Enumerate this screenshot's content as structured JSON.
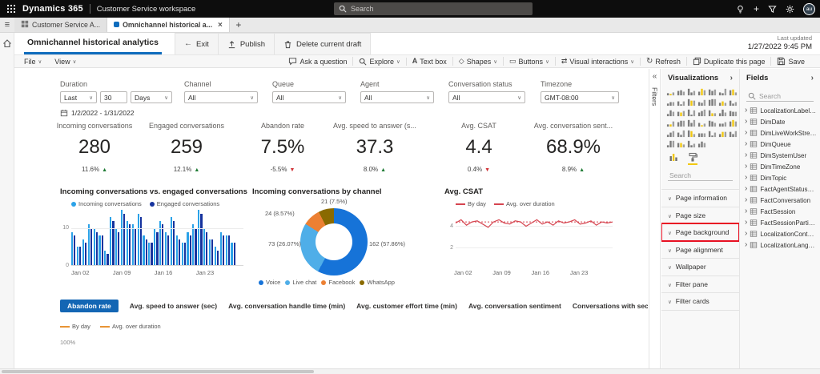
{
  "topbar": {
    "brand": "Dynamics 365",
    "app_name": "Customer Service workspace",
    "search_placeholder": "Search",
    "icons": [
      "lightbulb-icon",
      "add-icon",
      "filter-icon",
      "settings-icon"
    ],
    "avatar_initials": "au"
  },
  "browser_tabs": {
    "tab1_label": "Customer Service A...",
    "tab2_label": "Omnichannel historical a..."
  },
  "page_header": {
    "title_tab": "Omnichannel historical analytics",
    "exit_label": "Exit",
    "publish_label": "Publish",
    "delete_label": "Delete current draft",
    "last_updated_label": "Last updated",
    "last_updated_value": "1/27/2022 9:45 PM"
  },
  "menubar": {
    "file_label": "File",
    "view_label": "View",
    "tools": [
      {
        "label": "Ask a question",
        "icon": "chat-icon",
        "chevron": false
      },
      {
        "label": "Explore",
        "icon": "explore-icon",
        "chevron": true
      },
      {
        "label": "Text box",
        "icon": "textbox-icon",
        "chevron": false
      },
      {
        "label": "Shapes",
        "icon": "shapes-icon",
        "chevron": true
      },
      {
        "label": "Buttons",
        "icon": "buttons-icon",
        "chevron": true
      },
      {
        "label": "Visual interactions",
        "icon": "interactions-icon",
        "chevron": true
      },
      {
        "label": "Refresh",
        "icon": "refresh-icon",
        "chevron": false
      },
      {
        "label": "Duplicate this page",
        "icon": "duplicate-icon",
        "chevron": false
      },
      {
        "label": "Save",
        "icon": "save-icon",
        "chevron": false
      }
    ]
  },
  "filter_bar": {
    "duration": {
      "label": "Duration",
      "parts": [
        {
          "value": "Last"
        },
        {
          "value": "30"
        },
        {
          "value": "Days"
        }
      ]
    },
    "channel": {
      "label": "Channel",
      "value": "All"
    },
    "queue": {
      "label": "Queue",
      "value": "All"
    },
    "agent": {
      "label": "Agent",
      "value": "All"
    },
    "status": {
      "label": "Conversation status",
      "value": "All"
    },
    "timezone": {
      "label": "Timezone",
      "value": "GMT-08:00"
    },
    "date_range": "1/2/2022 - 1/31/2022"
  },
  "kpis": [
    {
      "label": "Incoming conversations",
      "value": "280",
      "delta": "11.6%",
      "dir": "up"
    },
    {
      "label": "Engaged conversations",
      "value": "259",
      "delta": "12.1%",
      "dir": "up"
    },
    {
      "label": "Abandon rate",
      "value": "7.5%",
      "delta": "-5.5%",
      "dir": "down"
    },
    {
      "label": "Avg. speed to answer (s...",
      "value": "37.3",
      "delta": "8.0%",
      "dir": "up"
    },
    {
      "label": "Avg. CSAT",
      "value": "4.4",
      "delta": "0.4%",
      "dir": "down"
    },
    {
      "label": "Avg. conversation sent...",
      "value": "68.9%",
      "delta": "8.9%",
      "dir": "up"
    }
  ],
  "chart_data": [
    {
      "type": "bar",
      "title": "Incoming conversations vs. engaged conversations",
      "xticks": [
        "Jan 02",
        "Jan 09",
        "Jan 16",
        "Jan 23"
      ],
      "yticks": [
        "10",
        "0"
      ],
      "ylim": [
        0,
        15
      ],
      "series": [
        {
          "name": "Incoming conversations",
          "color": "#2ba2e8",
          "values": [
            9,
            5,
            7,
            11,
            10,
            8,
            4,
            13,
            10,
            15,
            12,
            11,
            14,
            8,
            6,
            10,
            12,
            9,
            13,
            8,
            6,
            9,
            11,
            15,
            10,
            7,
            5,
            9,
            8,
            6
          ]
        },
        {
          "name": "Engaged conversations",
          "color": "#16339e",
          "values": [
            8,
            5,
            6,
            10,
            9,
            8,
            3,
            12,
            9,
            14,
            11,
            10,
            13,
            7,
            6,
            9,
            11,
            8,
            12,
            7,
            6,
            8,
            10,
            14,
            9,
            7,
            4,
            8,
            8,
            6
          ]
        }
      ]
    },
    {
      "type": "donut",
      "title": "Incoming conversations by channel",
      "slices": [
        {
          "name": "Voice",
          "value": 162,
          "label": "162 (57.86%)",
          "color": "#1673d8"
        },
        {
          "name": "Live chat",
          "value": 73,
          "label": "73 (26.07%)",
          "color": "#4faee8"
        },
        {
          "name": "Facebook",
          "value": 24,
          "label": "24 (8.57%)",
          "color": "#ec8033"
        },
        {
          "name": "WhatsApp",
          "value": 21,
          "label": "21 (7.5%)",
          "color": "#8a6a00"
        }
      ]
    },
    {
      "type": "line",
      "title": "Avg. CSAT",
      "legend": [
        "By day",
        "Avg. over duration"
      ],
      "color": "#d64550",
      "ylim": [
        1,
        5
      ],
      "yticks": [
        "4",
        "2"
      ],
      "xticks": [
        "Jan 02",
        "Jan 09",
        "Jan 16",
        "Jan 23"
      ],
      "avg": 4.4,
      "values": [
        4.3,
        4.6,
        4.1,
        4.4,
        4.5,
        4.2,
        3.9,
        4.4,
        4.6,
        4.3,
        4.2,
        4.5,
        4.4,
        4.0,
        4.3,
        4.6,
        4.2,
        4.4,
        4.1,
        4.5,
        4.3,
        4.4,
        4.6,
        4.2,
        4.3,
        4.5,
        4.1,
        4.4,
        4.3,
        4.4
      ]
    }
  ],
  "bottom_tabs": {
    "items": [
      "Abandon rate",
      "Avg. speed to answer (sec)",
      "Avg. conversation handle time (min)",
      "Avg. customer effort time (min)",
      "Avg. conversation sentiment",
      "Conversations with secondary channel"
    ],
    "selected_index": 0,
    "selected_bg": "#1366b4"
  },
  "bottom_chart": {
    "legend": [
      "By day",
      "Avg. over duration"
    ],
    "color": "#e89435",
    "ytick": "100%"
  },
  "filters_pane": {
    "title": "Filters"
  },
  "visualizations_pane": {
    "title": "Visualizations",
    "search_placeholder": "Search",
    "gallery": [
      "stacked-bar-chart",
      "stacked-column-chart",
      "clustered-bar-chart",
      "clustered-column-chart",
      "100-stacked-bar-chart",
      "100-stacked-column-chart",
      "line-chart",
      "area-chart",
      "stacked-area-chart",
      "line-and-stacked-column-chart",
      "line-and-clustered-column-chart",
      "ribbon-chart",
      "waterfall-chart",
      "funnel-chart",
      "scatter-chart",
      "pie-chart",
      "donut-chart",
      "treemap",
      "map",
      "filled-map",
      "shape-map",
      "azure-map",
      "gauge",
      "card",
      "multi-row-card",
      "kpi",
      "slicer",
      "table",
      "matrix",
      "r-script-visual",
      "python-visual",
      "key-influencers",
      "decomposition-tree",
      "qa-visual",
      "smart-narrative",
      "paginated-report",
      "arcgis-map",
      "power-apps",
      "power-automate"
    ],
    "sections": [
      {
        "label": "Page information"
      },
      {
        "label": "Page size"
      },
      {
        "label": "Page background",
        "highlighted": true
      },
      {
        "label": "Page alignment"
      },
      {
        "label": "Wallpaper"
      },
      {
        "label": "Filter pane"
      },
      {
        "label": "Filter cards"
      }
    ]
  },
  "fields_pane": {
    "title": "Fields",
    "search_placeholder": "Search",
    "fields": [
      "LocalizationLabelList",
      "DimDate",
      "DimLiveWorkStream",
      "DimQueue",
      "DimSystemUser",
      "DimTimeZone",
      "DimTopic",
      "FactAgentStatusHistory",
      "FactConversation",
      "FactSession",
      "FactSessionParticipant",
      "LocalizationContentPho...",
      "LocalizationLanguageL..."
    ]
  }
}
